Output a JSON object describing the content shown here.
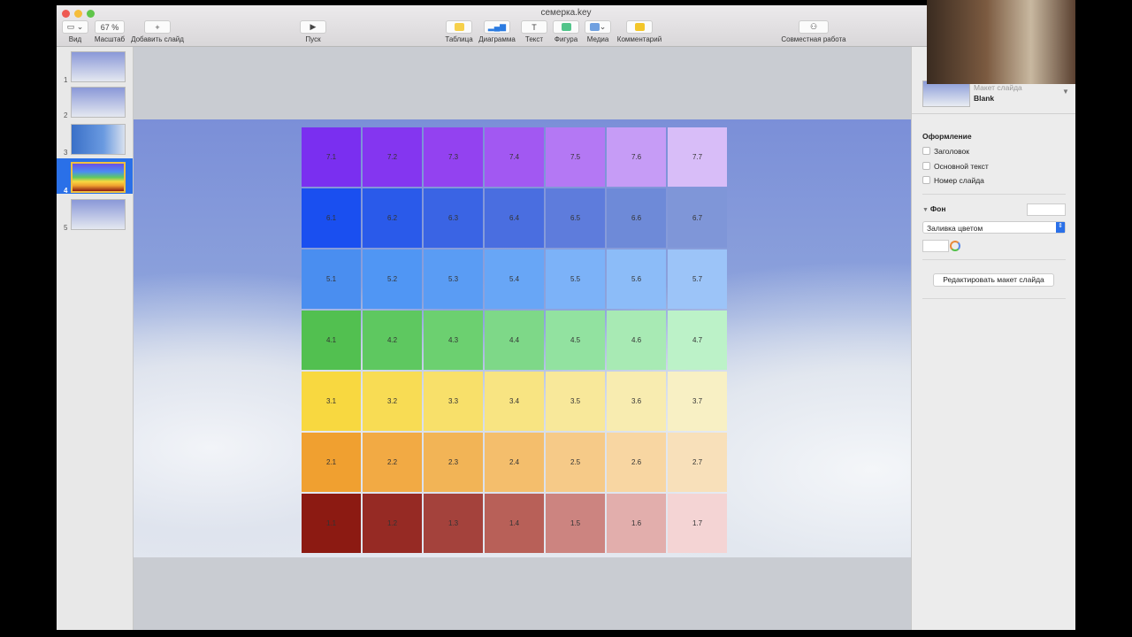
{
  "window": {
    "title": "семерка.key"
  },
  "toolbar": {
    "view": "Вид",
    "zoom_value": "67 %",
    "zoom": "Масштаб",
    "add_slide": "Добавить слайд",
    "play": "Пуск",
    "table": "Таблица",
    "chart": "Диаграмма",
    "text": "Текст",
    "shape": "Фигура",
    "media": "Медиа",
    "comment": "Комментарий",
    "collab": "Совместная работа"
  },
  "navigator": {
    "slides": [
      "1",
      "2",
      "3",
      "4",
      "5"
    ],
    "selected": "4"
  },
  "grid": {
    "rows": [
      {
        "labels": [
          "7.1",
          "7.2",
          "7.3",
          "7.4",
          "7.5",
          "7.6",
          "7.7"
        ],
        "colors": [
          "#7a2ff0",
          "#8436f0",
          "#9342f0",
          "#a258f2",
          "#b478f4",
          "#c69cf6",
          "#d8bdf8"
        ]
      },
      {
        "labels": [
          "6.1",
          "6.2",
          "6.3",
          "6.4",
          "6.5",
          "6.6",
          "6.7"
        ],
        "colors": [
          "#1a4ff0",
          "#2a5aea",
          "#3a64e4",
          "#4a6ee0",
          "#5e7cdc",
          "#6e8ad8",
          "#7f96d8"
        ]
      },
      {
        "labels": [
          "5.1",
          "5.2",
          "5.3",
          "5.4",
          "5.5",
          "5.6",
          "5.7"
        ],
        "colors": [
          "#4a8ef0",
          "#5096f4",
          "#5a9cf4",
          "#68a6f6",
          "#7cb2f8",
          "#8cbcf8",
          "#9cc4f8"
        ]
      },
      {
        "labels": [
          "4.1",
          "4.2",
          "4.3",
          "4.4",
          "4.5",
          "4.6",
          "4.7"
        ],
        "colors": [
          "#52c050",
          "#5ec860",
          "#6cd070",
          "#7ed888",
          "#92e2a0",
          "#a8eab4",
          "#bcf2c8"
        ]
      },
      {
        "labels": [
          "3.1",
          "3.2",
          "3.3",
          "3.4",
          "3.5",
          "3.6",
          "3.7"
        ],
        "colors": [
          "#f8d840",
          "#f8dc54",
          "#f8e06a",
          "#f8e482",
          "#f8e89a",
          "#f8ecb0",
          "#f8f0c4"
        ]
      },
      {
        "labels": [
          "2.1",
          "2.2",
          "2.3",
          "2.4",
          "2.5",
          "2.6",
          "2.7"
        ],
        "colors": [
          "#f0a030",
          "#f2aa44",
          "#f2b456",
          "#f4be6c",
          "#f6ca88",
          "#f8d6a2",
          "#f8e0ba"
        ]
      },
      {
        "labels": [
          "1.1",
          "1.2",
          "1.3",
          "1.4",
          "1.5",
          "1.6",
          "1.7"
        ],
        "colors": [
          "#8c1a12",
          "#962a24",
          "#a4423c",
          "#b86058",
          "#cc8480",
          "#e2aeac",
          "#f4d4d4"
        ]
      }
    ]
  },
  "panel": {
    "layout_label": "Макет слайда",
    "layout_value": "Blank",
    "appearance": "Оформление",
    "title_cb": "Заголовок",
    "body_cb": "Основной текст",
    "number_cb": "Номер слайда",
    "background": "Фон",
    "fill": "Заливка цветом",
    "edit_layout": "Редактировать макет слайда"
  }
}
